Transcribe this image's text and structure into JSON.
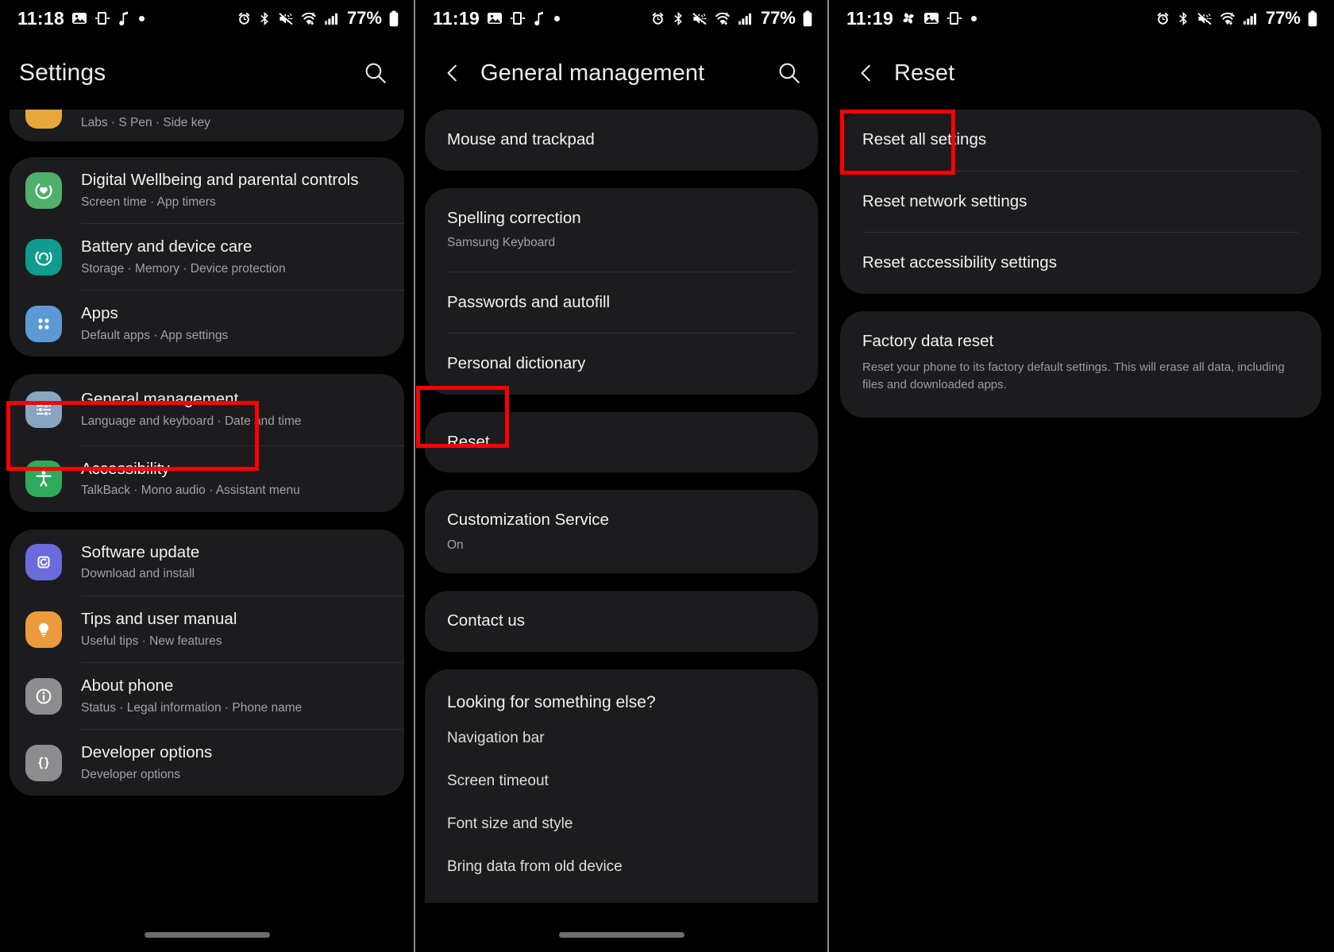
{
  "colors": {
    "highlight": "#ff0000",
    "card": "#1c1c1e",
    "background": "#000000",
    "icon_green": "#4fb06a",
    "icon_teal": "#0f9b8e",
    "icon_blue": "#5c9ad6",
    "icon_steel": "#8aa5bf",
    "icon_accgreen": "#2eaa5a",
    "icon_purple": "#6b6bdd",
    "icon_orange": "#eb9a3c",
    "icon_grey": "#8d8d8f",
    "icon_amber": "#e9a63a"
  },
  "panel1": {
    "status": {
      "time": "11:18",
      "battery_pct": "77%",
      "left_icons": [
        "photo-icon",
        "screen-record-icon",
        "music-note-icon",
        "dot-icon"
      ],
      "right_icons": [
        "alarm-icon",
        "bluetooth-icon",
        "mute-icon",
        "wifi6-icon",
        "signal-icon",
        "battery-icon"
      ]
    },
    "appbar": {
      "title": "Settings",
      "search_icon": "search-icon"
    },
    "partial_card": {
      "subtitle": "Labs  ·  S Pen  ·  Side key",
      "icon": "advanced-features-icon"
    },
    "group1": [
      {
        "title": "Digital Wellbeing and parental controls",
        "subtitle": "Screen time  ·  App timers",
        "icon": "wellbeing-icon",
        "color": "#4fb06a"
      },
      {
        "title": "Battery and device care",
        "subtitle": "Storage  ·  Memory  ·  Device protection",
        "icon": "device-care-icon",
        "color": "#0f9b8e"
      },
      {
        "title": "Apps",
        "subtitle": "Default apps  ·  App settings",
        "icon": "apps-grid-icon",
        "color": "#5c9ad6"
      }
    ],
    "group2": [
      {
        "title": "General management",
        "subtitle": "Language and keyboard  ·  Date and time",
        "icon": "sliders-icon",
        "color": "#8aa5bf",
        "highlighted": true
      },
      {
        "title": "Accessibility",
        "subtitle": "TalkBack  ·  Mono audio  ·  Assistant menu",
        "icon": "accessibility-icon",
        "color": "#2eaa5a",
        "highlighted": false
      }
    ],
    "group3": [
      {
        "title": "Software update",
        "subtitle": "Download and install",
        "icon": "software-update-icon",
        "color": "#6b6bdd"
      },
      {
        "title": "Tips and user manual",
        "subtitle": "Useful tips  ·  New features",
        "icon": "lightbulb-icon",
        "color": "#eb9a3c"
      },
      {
        "title": "About phone",
        "subtitle": "Status  ·  Legal information  ·  Phone name",
        "icon": "info-icon",
        "color": "#8d8d8f"
      },
      {
        "title": "Developer options",
        "subtitle": "Developer options",
        "icon": "braces-icon",
        "color": "#8d8d8f"
      }
    ]
  },
  "panel2": {
    "status": {
      "time": "11:19",
      "battery_pct": "77%",
      "left_icons": [
        "photo-icon",
        "screen-record-icon",
        "music-note-icon",
        "dot-icon"
      ],
      "right_icons": [
        "alarm-icon",
        "bluetooth-icon",
        "mute-icon",
        "wifi6-icon",
        "signal-icon",
        "battery-icon"
      ]
    },
    "appbar": {
      "back_icon": "chevron-left-icon",
      "title": "General management",
      "search_icon": "search-icon"
    },
    "card1": [
      {
        "title": "Mouse and trackpad"
      }
    ],
    "card2": [
      {
        "title": "Spelling correction",
        "subtitle": "Samsung Keyboard"
      },
      {
        "title": "Passwords and autofill"
      },
      {
        "title": "Personal dictionary"
      }
    ],
    "card3": [
      {
        "title": "Reset",
        "highlighted": true
      }
    ],
    "card4": [
      {
        "title": "Customization Service",
        "subtitle": "On"
      }
    ],
    "card5": [
      {
        "title": "Contact us"
      }
    ],
    "card6": {
      "heading": "Looking for something else?",
      "items": [
        "Navigation bar",
        "Screen timeout",
        "Font size and style",
        "Bring data from old device"
      ]
    }
  },
  "panel3": {
    "status": {
      "time": "11:19",
      "battery_pct": "77%",
      "left_icons": [
        "fan-icon",
        "photo-icon",
        "screen-record-icon",
        "dot-icon"
      ],
      "right_icons": [
        "alarm-icon",
        "bluetooth-icon",
        "mute-icon",
        "wifi6-icon",
        "signal-icon",
        "battery-icon"
      ]
    },
    "appbar": {
      "back_icon": "chevron-left-icon",
      "title": "Reset"
    },
    "card1": [
      {
        "title": "Reset all settings",
        "highlighted": true
      },
      {
        "title": "Reset network settings"
      },
      {
        "title": "Reset accessibility settings"
      }
    ],
    "card2": [
      {
        "title": "Factory data reset",
        "desc": "Reset your phone to its factory default settings. This will erase all data, including files and downloaded apps."
      }
    ]
  }
}
